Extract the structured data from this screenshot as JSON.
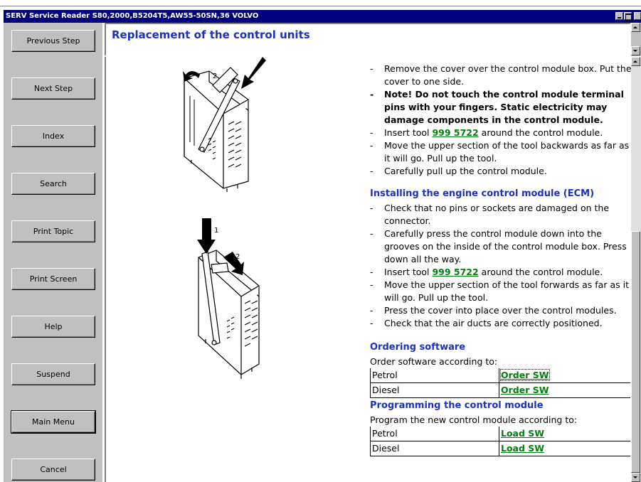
{
  "window": {
    "title": "SERV Service Reader S80,2000,B5204T5,AW55-50SN,36 VOLVO"
  },
  "sidebar": {
    "buttons": [
      {
        "label": "Previous Step"
      },
      {
        "label": "Next Step"
      },
      {
        "label": "Index"
      },
      {
        "label": "Search"
      },
      {
        "label": "Print Topic"
      },
      {
        "label": "Print Screen"
      },
      {
        "label": "Help"
      },
      {
        "label": "Suspend"
      },
      {
        "label": "Main Menu"
      },
      {
        "label": "Cancel"
      }
    ]
  },
  "header": {
    "title": "Replacement of the control units"
  },
  "content": {
    "remove_steps": [
      "Remove the cover over the control module box. Put the cover to one side.",
      "Note! Do not touch the control module terminal pins with your fingers. Static electricity may damage components in the control module.",
      "Insert tool ",
      "Move the upper section of the tool backwards as far as it will go. Pull up the tool.",
      "Carefully pull up the control module."
    ],
    "tool_link": "999 5722",
    "tool_suffix": " around the control module.",
    "install_heading": "Installing the engine control module (ECM)",
    "install_steps": [
      "Check that no pins or sockets are damaged on the connector.",
      "Carefully press the control module down into the grooves on the inside of the control module box. Press down all the way.",
      "Insert tool ",
      "Move the upper section of the tool forwards as far as it will go. Pull up the tool.",
      "Press the cover into place over the control modules.",
      "Check that the air ducts are correctly positioned."
    ],
    "ordering_heading": "Ordering software",
    "ordering_intro": "Order software according to:",
    "ordering_rows": [
      {
        "fuel": "Petrol",
        "link": "Order SW"
      },
      {
        "fuel": "Diesel",
        "link": "Order SW"
      }
    ],
    "programming_heading": "Programming the control module",
    "programming_intro": "Program the new control module according to:",
    "programming_rows": [
      {
        "fuel": "Petrol",
        "link": "Load SW"
      },
      {
        "fuel": "Diesel",
        "link": "Load SW"
      }
    ],
    "figure_labels": {
      "fig1_step": "2",
      "fig2_step1": "1",
      "fig2_step2": "2"
    }
  },
  "colors": {
    "title_bar": "#000080",
    "heading": "#1a30c8",
    "link": "#00800f",
    "panel": "#c0c0c0"
  }
}
